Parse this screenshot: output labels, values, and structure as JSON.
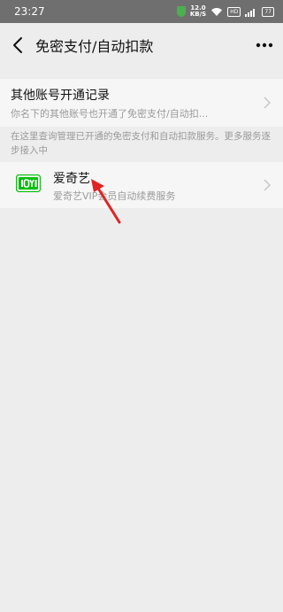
{
  "status_bar": {
    "time": "23:27",
    "speed_value": "12.0",
    "speed_unit": "KB/S",
    "hd_badge": "HD",
    "signal_label": "4G",
    "battery_level": "77"
  },
  "header": {
    "title": "免密支付/自动扣款"
  },
  "other_accounts": {
    "title": "其他账号开通记录",
    "subtitle": "你名下的其他账号也开通了免密支付/自动扣..."
  },
  "notice": {
    "text": "在这里查询管理已开通的免密支付和自动扣款服务。更多服务逐步接入中"
  },
  "services": [
    {
      "name": "爱奇艺",
      "description": "爱奇艺VIP会员自动续费服务",
      "icon": "iqiyi-logo-icon",
      "brand_color": "#00be06"
    }
  ],
  "colors": {
    "status_bar_bg": "#6f6f6f",
    "page_bg": "#ededed",
    "card_bg": "#f6f6f6",
    "annotation_arrow": "#e02424"
  }
}
